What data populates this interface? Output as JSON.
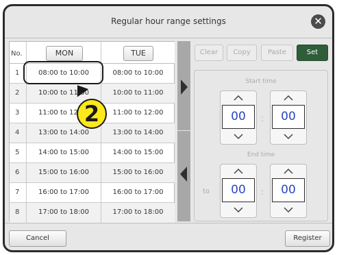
{
  "window": {
    "title": "Regular hour range settings"
  },
  "table": {
    "no_header": "No.",
    "days": [
      "MON",
      "TUE"
    ],
    "rows": [
      {
        "no": "1",
        "mon": "08:00 to 10:00",
        "tue": "08:00 to 10:00"
      },
      {
        "no": "2",
        "mon": "10:00 to 11:00",
        "tue": "10:00 to 11:00"
      },
      {
        "no": "3",
        "mon": "11:00 to 12:00",
        "tue": "11:00 to 12:00"
      },
      {
        "no": "4",
        "mon": "13:00 to 14:00",
        "tue": "13:00 to 14:00"
      },
      {
        "no": "5",
        "mon": "14:00 to 15:00",
        "tue": "14:00 to 15:00"
      },
      {
        "no": "6",
        "mon": "15:00 to 16:00",
        "tue": "15:00 to 16:00"
      },
      {
        "no": "7",
        "mon": "16:00 to 17:00",
        "tue": "16:00 to 17:00"
      },
      {
        "no": "8",
        "mon": "17:00 to 18:00",
        "tue": "17:00 to 18:00"
      }
    ]
  },
  "callout": {
    "number": "2",
    "color": "#ffe81a"
  },
  "toolbar": {
    "clear": "Clear",
    "copy": "Copy",
    "paste": "Paste",
    "set": "Set",
    "set_color": "#2e5d3a"
  },
  "time": {
    "start_label": "Start time",
    "end_label": "End time",
    "to_label": "to",
    "separator": ":",
    "start_hour": "00",
    "start_min": "00",
    "end_hour": "00",
    "end_min": "00",
    "value_color": "#2a46c0"
  },
  "footer": {
    "cancel": "Cancel",
    "register": "Register"
  },
  "icons": {
    "close": "close-icon",
    "move_right": "arrow-right-icon",
    "move_left": "arrow-left-icon",
    "up": "chevron-up-icon",
    "down": "chevron-down-icon"
  }
}
